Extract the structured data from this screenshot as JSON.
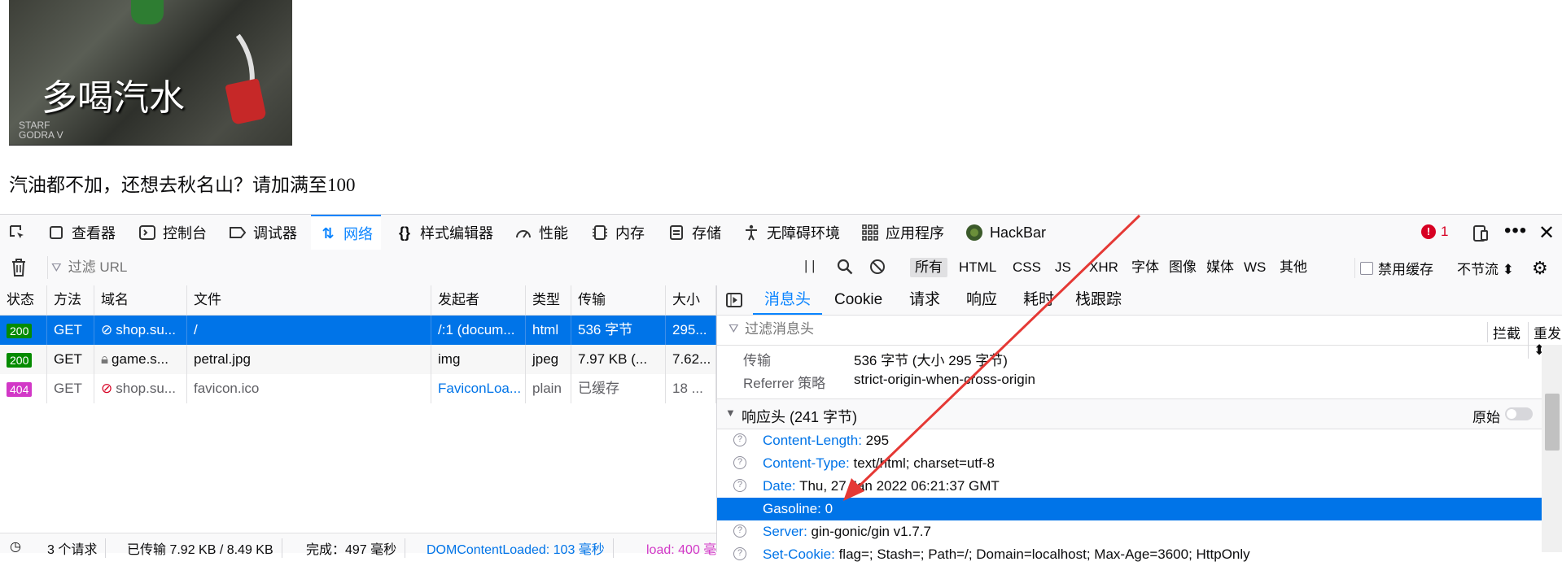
{
  "page": {
    "image_caption": "多喝汽水",
    "image_small_text": "STARF\nGODRA V",
    "message": "汽油都不加，还想去秋名山？请加满至100"
  },
  "devtools": {
    "tabs": [
      {
        "label": "查看器",
        "icon": "inspector-icon"
      },
      {
        "label": "控制台",
        "icon": "console-icon"
      },
      {
        "label": "调试器",
        "icon": "debugger-icon"
      },
      {
        "label": "网络",
        "icon": "network-icon"
      },
      {
        "label": "样式编辑器",
        "icon": "style-editor-icon"
      },
      {
        "label": "性能",
        "icon": "performance-icon"
      },
      {
        "label": "内存",
        "icon": "memory-icon"
      },
      {
        "label": "存储",
        "icon": "storage-icon"
      },
      {
        "label": "无障碍环境",
        "icon": "accessibility-icon"
      },
      {
        "label": "应用程序",
        "icon": "application-icon"
      },
      {
        "label": "HackBar",
        "icon": "hackbar-icon"
      }
    ],
    "active_tab": "网络",
    "error_count": "1",
    "network": {
      "filter_placeholder": "过滤 URL",
      "pause_glyph": "| |",
      "type_filters": [
        "所有",
        "HTML",
        "CSS",
        "JS",
        "XHR",
        "字体",
        "图像",
        "媒体",
        "WS",
        "其他"
      ],
      "active_filter": "所有",
      "disable_cache_label": "禁用缓存",
      "throttle_label": "不节流 ⬍",
      "columns": [
        "状态",
        "方法",
        "域名",
        "文件",
        "发起者",
        "类型",
        "传输",
        "大小"
      ],
      "requests": [
        {
          "status": "200",
          "method": "GET",
          "domain": "shop.su...",
          "file": "/",
          "initiator": "/:1 (docum...",
          "type": "html",
          "transfer": "536 字节",
          "size": "295..."
        },
        {
          "status": "200",
          "method": "GET",
          "domain": "game.s...",
          "file": "petral.jpg",
          "initiator": "img",
          "type": "jpeg",
          "transfer": "7.97 KB (...",
          "size": "7.62..."
        },
        {
          "status": "404",
          "method": "GET",
          "domain": "shop.su...",
          "file": "favicon.ico",
          "initiator": "FaviconLoa...",
          "type": "plain",
          "transfer": "已缓存",
          "size": "18 ..."
        }
      ],
      "status_bar": {
        "requests": "3 个请求",
        "transferred": "已传输 7.92 KB / 8.49 KB",
        "finish": "完成：497 毫秒",
        "dcl": "DOMContentLoaded: 103 毫秒",
        "load": "load: 400 毫"
      }
    },
    "details": {
      "tabs": [
        "消息头",
        "Cookie",
        "请求",
        "响应",
        "耗时",
        "栈跟踪"
      ],
      "active_tab": "消息头",
      "filter_placeholder": "过滤消息头",
      "block_label": "拦截",
      "resend_label": "重发 ⬍",
      "summary": [
        {
          "key": "传输",
          "value": "536 字节 (大小 295 字节)"
        },
        {
          "key": "Referrer 策略",
          "value": "strict-origin-when-cross-origin"
        }
      ],
      "response_section": "响应头 (241 字节)",
      "raw_label": "原始",
      "headers": [
        {
          "name": "Content-Length:",
          "value": "295"
        },
        {
          "name": "Content-Type:",
          "value": "text/html; charset=utf-8"
        },
        {
          "name": "Date:",
          "value": "Thu, 27 Jan 2022 06:21:37 GMT"
        },
        {
          "name": "Gasoline:",
          "value": "0"
        },
        {
          "name": "Server:",
          "value": "gin-gonic/gin v1.7.7"
        },
        {
          "name": "Set-Cookie:",
          "value": "flag=; Stash=; Path=/; Domain=localhost; Max-Age=3600; HttpOnly"
        }
      ],
      "selected_header": "Gasoline:"
    }
  },
  "colors": {
    "accent": "#0a84ff",
    "selection": "#0074e8",
    "status_200": "#058b00",
    "status_404": "#d238c7",
    "annotation_arrow": "#e53935",
    "error_badge": "#d70022"
  }
}
